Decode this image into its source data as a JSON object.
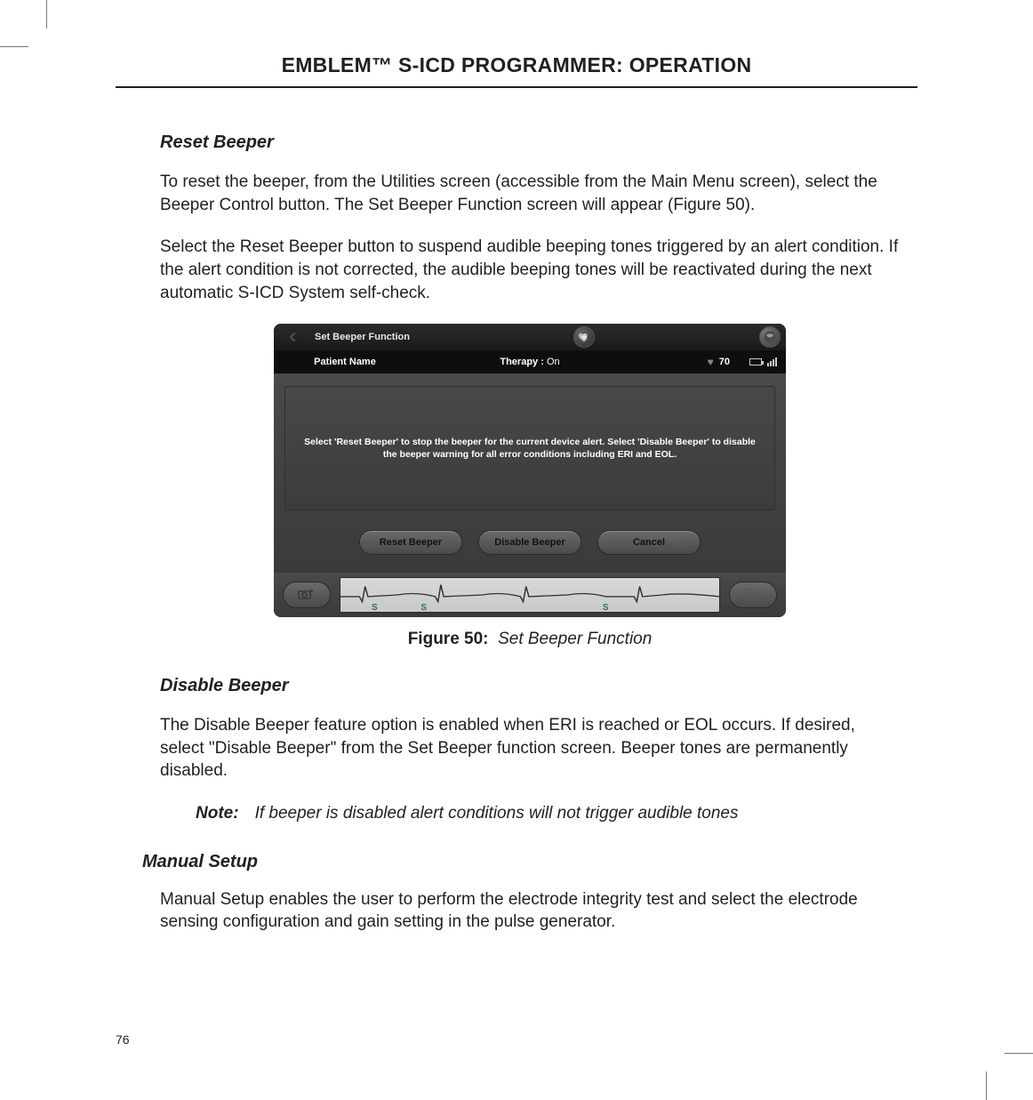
{
  "page": {
    "header": "EMBLEM™ S-ICD PROGRAMMER: OPERATION",
    "number": "76"
  },
  "sections": {
    "reset_beeper": {
      "heading": "Reset Beeper",
      "p1": "To reset the beeper, from the Utilities screen (accessible from the Main Menu screen), select the Beeper Control button. The Set Beeper Function screen will appear (Figure 50).",
      "p2": "Select the Reset Beeper button to suspend audible beeping tones triggered by an alert condition. If the alert condition is not corrected, the audible beeping tones will be reactivated during the next automatic S-ICD System self-check."
    },
    "disable_beeper": {
      "heading": "Disable Beeper",
      "p1": "The Disable Beeper feature option is enabled when ERI is reached or EOL occurs. If desired, select \"Disable Beeper\" from the Set Beeper function screen. Beeper tones are permanently disabled.",
      "note_label": "Note:",
      "note_text": "If beeper is disabled alert conditions will not trigger audible tones"
    },
    "manual_setup": {
      "heading": "Manual Setup",
      "p1": "Manual Setup enables the user to perform the electrode integrity test and select the electrode sensing configuration and gain setting in the pulse generator."
    }
  },
  "figure": {
    "label": "Figure 50:",
    "caption": "Set Beeper Function"
  },
  "device": {
    "titlebar": {
      "title": "Set Beeper Function"
    },
    "status": {
      "patient_label": "Patient Name",
      "therapy_label": "Therapy :",
      "therapy_value": "On",
      "rate": "70"
    },
    "instruction": "Select 'Reset Beeper' to stop the beeper for the current device alert. Select 'Disable Beeper' to disable the beeper warning for all error conditions including ERI and EOL.",
    "buttons": {
      "reset": "Reset Beeper",
      "disable": "Disable Beeper",
      "cancel": "Cancel"
    }
  }
}
